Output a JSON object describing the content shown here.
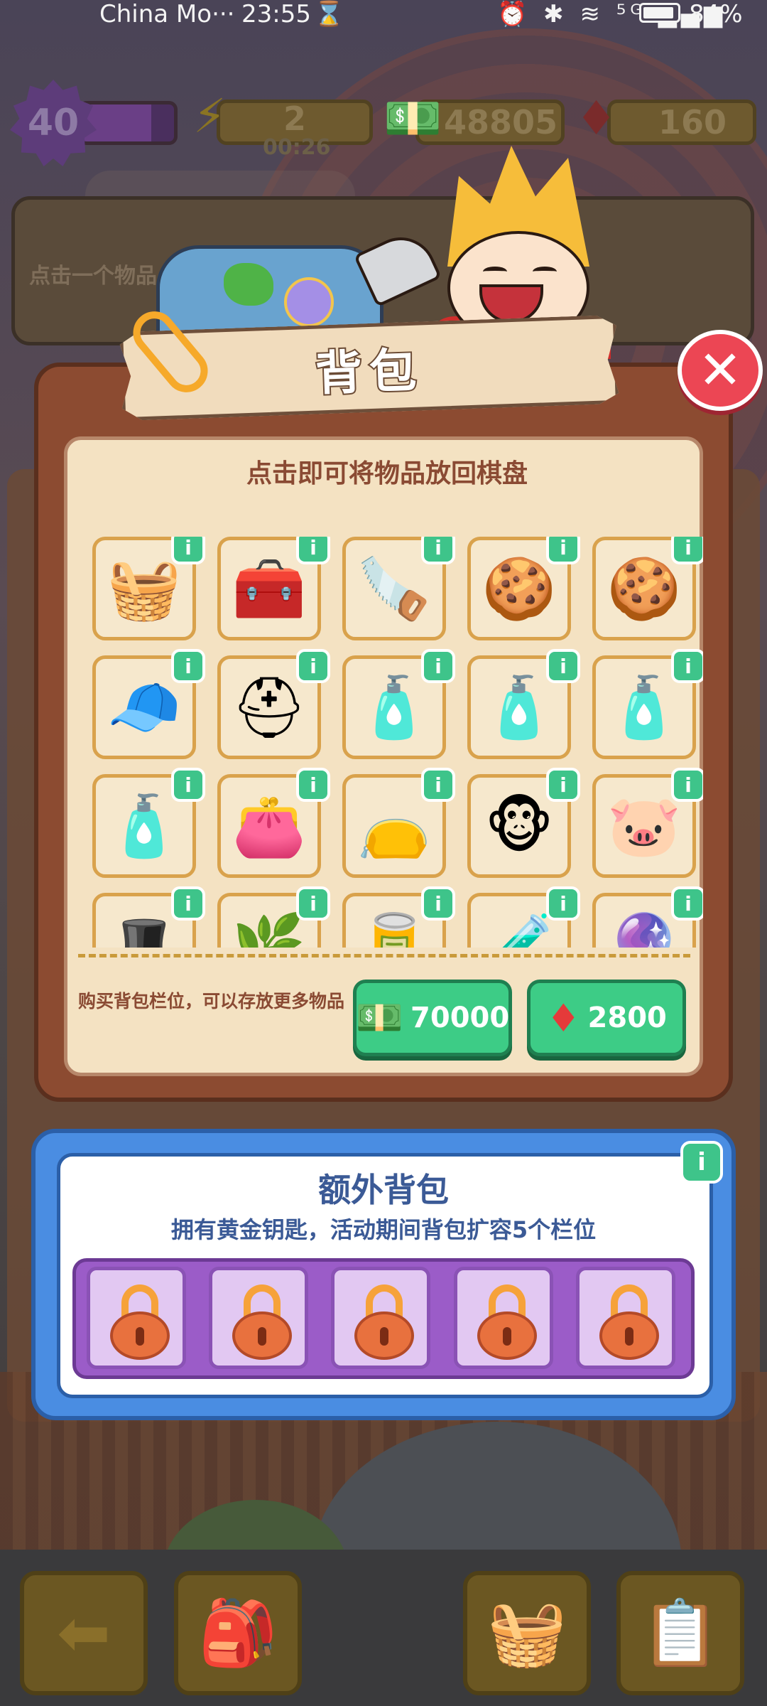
{
  "status_bar": {
    "carrier": "China Mo···",
    "time": "23:55",
    "hourglass": "⌛",
    "sys_icons": "⏰ ✱ ≋ ⁵ᴳ ▂▄▆",
    "battery": "84%"
  },
  "hud": {
    "level": "40",
    "level_progress": 0.75,
    "energy": "2",
    "energy_timer": "00:26",
    "cash": "48805",
    "gems": "160"
  },
  "hint_panel": {
    "text": "点击一个物品，查看它的"
  },
  "backpack": {
    "title": "背包",
    "close_glyph": "✕",
    "subtitle": "点击即可将物品放回棋盘",
    "info_glyph": "i",
    "items": [
      {
        "icon": "red-tray-icon",
        "glyph": "🧺"
      },
      {
        "icon": "red-toolbox-icon",
        "glyph": "🧰"
      },
      {
        "icon": "hand-saw-icon",
        "glyph": "🪚"
      },
      {
        "icon": "cookie-pieces-icon",
        "glyph": "🍪"
      },
      {
        "icon": "baking-tray-icon",
        "glyph": "🍪"
      },
      {
        "icon": "yellow-cap-icon",
        "glyph": "🧢"
      },
      {
        "icon": "yellow-helmet-icon",
        "glyph": "⛑"
      },
      {
        "icon": "cleaner-bottle-small-icon",
        "glyph": "🧴"
      },
      {
        "icon": "cleaner-bottle-icon",
        "glyph": "🧴"
      },
      {
        "icon": "cleaner-spray-icon",
        "glyph": "🧴"
      },
      {
        "icon": "spray-bottle-icon",
        "glyph": "🧴"
      },
      {
        "icon": "leather-wallet-icon",
        "glyph": "👛"
      },
      {
        "icon": "leather-wallet-stack-icon",
        "glyph": "👝"
      },
      {
        "icon": "monkey-statue-icon",
        "glyph": "🐵"
      },
      {
        "icon": "pig-statue-icon",
        "glyph": "🐷"
      },
      {
        "icon": "purple-hat-icon",
        "glyph": "🎩"
      },
      {
        "icon": "green-plant-icon",
        "glyph": "🌿"
      },
      {
        "icon": "bronze-tube-icon",
        "glyph": "🥫"
      },
      {
        "icon": "blue-tube-icon",
        "glyph": "🧪"
      },
      {
        "icon": "star-orb-icon",
        "glyph": "🔮"
      }
    ],
    "buy_text": "购买背包栏位，可以存放更多物品",
    "buy_cash": "70000",
    "buy_gems": "2800"
  },
  "extra_backpack": {
    "title": "额外背包",
    "subtitle": "拥有黄金钥匙，活动期间背包扩容5个栏位",
    "slots": [
      {},
      {},
      {},
      {},
      {}
    ]
  },
  "colors": {
    "accent_green": "#3dcc86",
    "close_red": "#ec4654",
    "modal_brown": "#8c4b31",
    "extra_blue": "#4a8de2",
    "lock_purple": "#9b5cc8"
  }
}
